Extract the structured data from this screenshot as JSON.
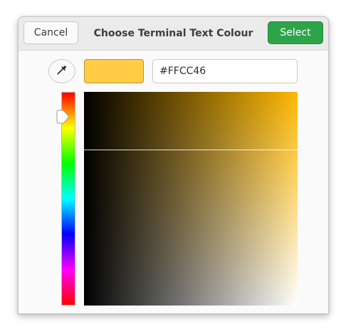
{
  "dialog": {
    "title": "Choose Terminal Text Colour",
    "cancel_label": "Cancel",
    "select_label": "Select"
  },
  "editor": {
    "hex_value": "#FFCC46",
    "current_color": "#ffcc46",
    "hue_color": "#ffb800",
    "hue_degrees": 43,
    "picker_icon": "color-picker-eyedropper-icon"
  }
}
